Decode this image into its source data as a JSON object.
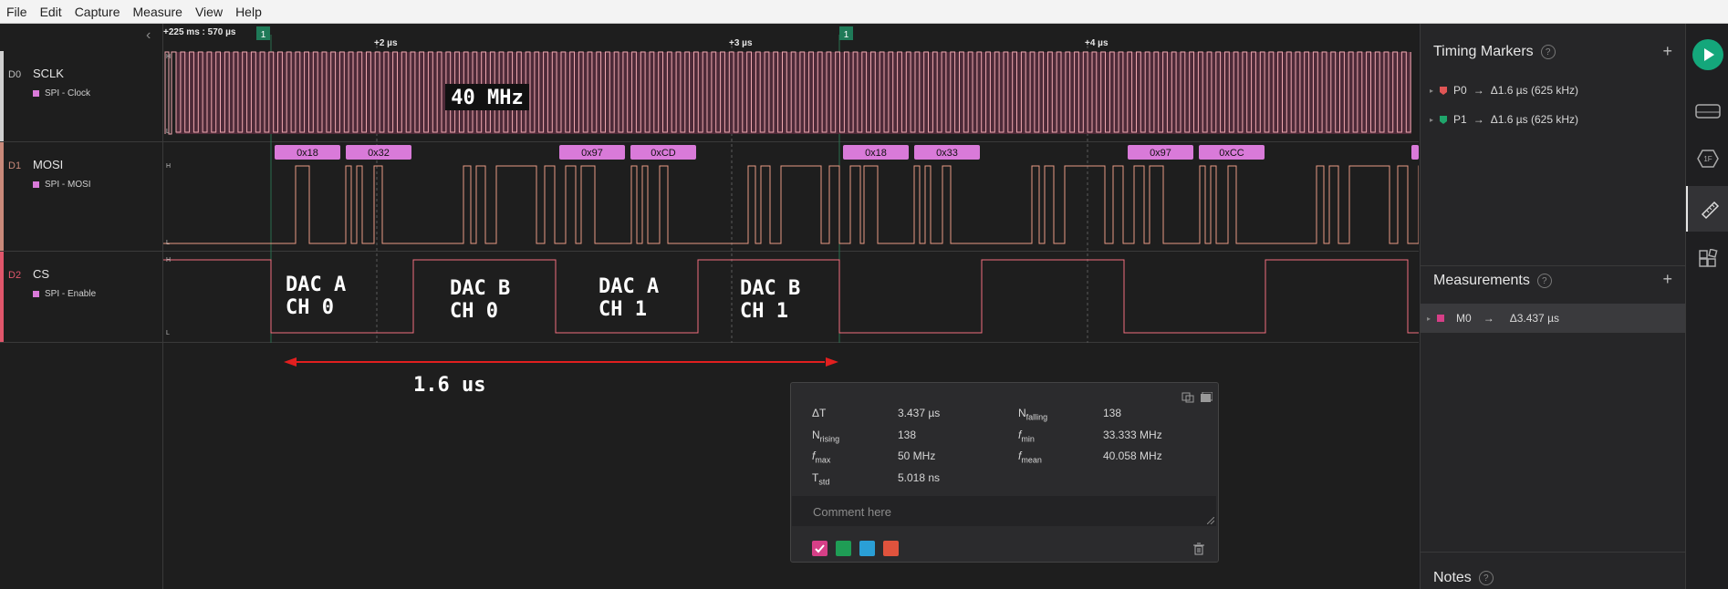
{
  "menu": [
    "File",
    "Edit",
    "Capture",
    "Measure",
    "View",
    "Help"
  ],
  "timeline": {
    "start_label": "+225 ms : 570 µs",
    "ticks": [
      "+2 µs",
      "+3 µs",
      "+4 µs"
    ],
    "marker_flag": "1"
  },
  "channels": [
    {
      "id": "D0",
      "name": "SCLK",
      "analyzer": "SPI - Clock",
      "color": "#d8d8d8"
    },
    {
      "id": "D1",
      "name": "MOSI",
      "analyzer": "SPI - MOSI",
      "color": "#c9897a"
    },
    {
      "id": "D2",
      "name": "CS",
      "analyzer": "SPI - Enable",
      "color": "#e0566b"
    }
  ],
  "level_labels": {
    "high": "H",
    "low": "L"
  },
  "clock_annotation": "40 MHz",
  "mosi_bytes": [
    "0x18",
    "0x32",
    "0x97",
    "0xCD",
    "0x18",
    "0x33",
    "0x97",
    "0xCC"
  ],
  "cs_labels": [
    {
      "line1": "DAC A",
      "line2": "CH 0"
    },
    {
      "line1": "DAC B",
      "line2": "CH 0"
    },
    {
      "line1": "DAC A",
      "line2": "CH 1"
    },
    {
      "line1": "DAC B",
      "line2": "CH 1"
    }
  ],
  "span_annotation": "1.6 us",
  "timing_markers": {
    "title": "Timing Markers",
    "help": "?",
    "items": [
      {
        "name": "P0",
        "arrow": "→",
        "value": "Δ1.6 µs (625 kHz)",
        "color": "#e05555"
      },
      {
        "name": "P1",
        "arrow": "→",
        "value": "Δ1.6 µs (625 kHz)",
        "color": "#1fa56b"
      }
    ]
  },
  "measurements": {
    "title": "Measurements",
    "help": "?",
    "items": [
      {
        "name": "M0",
        "arrow": "→",
        "value": "Δ3.437 µs",
        "color": "#d63f87"
      }
    ]
  },
  "notes": {
    "title": "Notes",
    "help": "?"
  },
  "measurement_popup": {
    "rows_left": [
      {
        "label": "ΔT",
        "sub": "",
        "value": "3.437 µs"
      },
      {
        "label": "N",
        "sub": "rising",
        "value": "138"
      },
      {
        "label": "f",
        "sub": "max",
        "value": "50 MHz"
      },
      {
        "label": "T",
        "sub": "std",
        "value": "5.018 ns"
      }
    ],
    "rows_right": [
      {
        "label": "N",
        "sub": "falling",
        "value": "138"
      },
      {
        "label": "f",
        "sub": "min",
        "value": "33.333 MHz"
      },
      {
        "label": "f",
        "sub": "mean",
        "value": "40.058 MHz"
      }
    ],
    "comment_placeholder": "Comment here",
    "swatch_colors": [
      "#d63f87",
      "#1f9d55",
      "#2a9fd6",
      "#e0533d"
    ]
  }
}
